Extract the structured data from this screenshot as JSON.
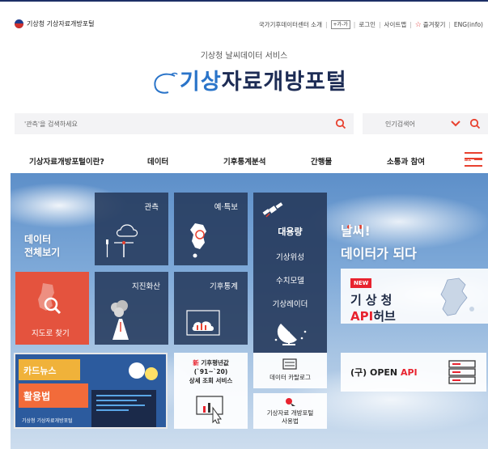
{
  "utility": {
    "logo_text": "기상청 기상자료개방포털",
    "links": [
      "국가기후데이터센터 소개",
      "로그인",
      "사이트맵",
      "즐겨찾기",
      "ENG(info)"
    ],
    "font_plus": "+가",
    "font_minus": "-가"
  },
  "brand": {
    "subtitle": "기상청 날씨데이터 서비스",
    "title_part1": "기상",
    "title_part2": "자료개방포털"
  },
  "search": {
    "placeholder": "'관측'을 검색하세요",
    "popular_label": "인기검색어"
  },
  "nav": {
    "items": [
      "기상자료개방포털이란?",
      "데이터",
      "기후통계분석",
      "간행물",
      "소통과 참여"
    ],
    "menu_all": "ALL"
  },
  "hero": {
    "data_all_line1": "데이터",
    "data_all_line2": "전체보기",
    "tile_observation": "관측",
    "tile_forecast": "예·특보",
    "tile_map_search": "지도로 찾기",
    "tile_dispersion": "지진화산",
    "tile_climate_stats": "기후통계",
    "bigdata_title": "대용량",
    "bigdata_items": [
      "기상위성",
      "수치모델",
      "기상레이더"
    ],
    "slogan_line1": "날씨!",
    "slogan_line2": "데이터가 되다",
    "api_new": "NEW",
    "api_line1": "기상청",
    "api_line2_red": "API",
    "api_line2_dark": "허브",
    "card_news_text": "카드뉴스 기상청 오픈 API 활용법",
    "card_news_logo": "기상청 기상자료개방포털",
    "normals_new": "新",
    "normals_line1": "기후평년값",
    "normals_line2": "(`91~`20)",
    "normals_line3": "상세 조회 서비스",
    "catalog": "데이터 카탈로그",
    "usage_line1": "기상자료 개방포털",
    "usage_line2": "사용법",
    "open_api_prefix": "(구) OPEN ",
    "open_api_red": "API"
  },
  "colors": {
    "brand_blue": "#2a74c9",
    "brand_navy": "#1d2c55",
    "accent_red": "#e8412f",
    "tile_dark": "#263a5c",
    "tile_red": "#e4533e"
  }
}
